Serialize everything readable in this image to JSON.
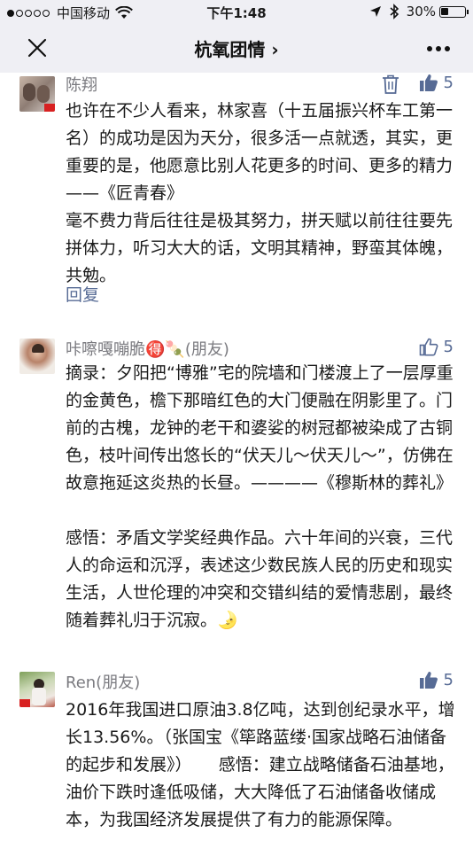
{
  "status_bar": {
    "carrier": "中国移动",
    "time": "下午1:48",
    "battery_text": "30%",
    "battery_level": 0.3,
    "signal_dots": 5,
    "signal_filled": 1
  },
  "nav": {
    "title": "杭氧团情",
    "title_suffix": "›"
  },
  "comments": [
    {
      "name": "陈翔",
      "likes": "5",
      "liked": true,
      "deletable": true,
      "text": "也许在不少人看来，林家喜（十五届振兴杯车工第一名）的成功是因为天分，很多活一点就透，其实，更重要的是，他愿意比别人花更多的时间、更多的精力——《匠青春》\n毫不费力背后往往是极其努力，拼天赋以前往往要先拼体力，听习大大的话，文明其精神，野蛮其体魄，共勉。",
      "reply_label": "回复"
    },
    {
      "name": "咔嚓嘎嘣脆🉐🍡(朋友)",
      "likes": "5",
      "liked": false,
      "text": "摘录：夕阳把“博雅”宅的院墙和门楼渡上了一层厚重的金黄色，檐下那暗红色的大门便融在阴影里了。门前的古槐，龙钟的老干和婆娑的树冠都被染成了古铜色，枝叶间传出悠长的“伏天儿～伏天儿～”，仿佛在故意拖延这炎热的长昼。————《穆斯林的葬礼》\n\n感悟：矛盾文学奖经典作品。六十年间的兴衰，三代人的命运和沉浮，表述这少数民族人民的历史和现实生活，人世伦理的冲突和交错纠结的爱情悲剧，最终随着葬礼归于沉寂。🌛"
    },
    {
      "name": "Ren(朋友)",
      "likes": "5",
      "liked": true,
      "text": "2016年我国进口原油3.8亿吨，达到创纪录水平，增长13.56%。（张国宝《筚路蓝缕·国家战略石油储备的起步和发展》）     感悟：建立战略储备石油基地，油价下跌时逢低吸储，大大降低了石油储备收储成本，为我国经济发展提供了有力的能源保障。"
    }
  ],
  "colors": {
    "link": "#576b95",
    "name": "#7b7b80",
    "background": "#efeff4"
  }
}
